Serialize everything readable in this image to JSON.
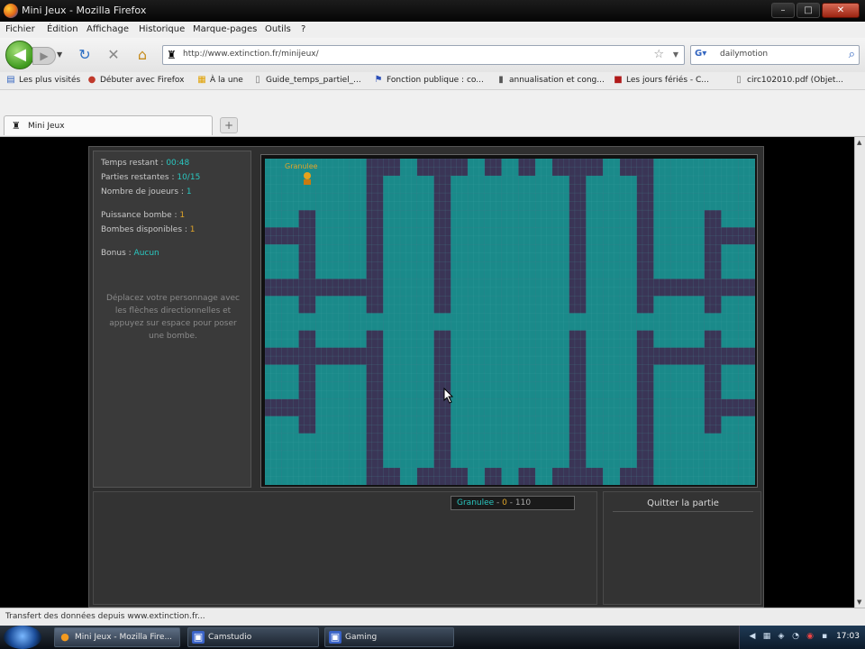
{
  "window": {
    "title": "Mini Jeux - Mozilla Firefox",
    "min": "–",
    "max": "□",
    "close": "✕"
  },
  "menu": [
    "Fichier",
    "Édition",
    "Affichage",
    "Historique",
    "Marque-pages",
    "Outils",
    "?"
  ],
  "nav": {
    "url": "http://www.extinction.fr/minijeux/",
    "search_value": "dailymotion",
    "search_engine_icon": "google-icon"
  },
  "bookmarks": [
    {
      "label": "Les plus visités",
      "icon": "bookmark-icon"
    },
    {
      "label": "Débuter avec Firefox",
      "icon": "firefox-icon"
    },
    {
      "label": "À la une",
      "icon": "rss-icon"
    },
    {
      "label": "Guide_temps_partiel_...",
      "icon": "page-icon"
    },
    {
      "label": "Fonction publique : co...",
      "icon": "flag-icon"
    },
    {
      "label": "annualisation et cong...",
      "icon": "page-icon"
    },
    {
      "label": "Les jours fériés - C...",
      "icon": "red-page-icon"
    },
    {
      "label": "circ102010.pdf (Objet...",
      "icon": "pdf-icon"
    }
  ],
  "tabs": [
    {
      "label": "Mini Jeux"
    }
  ],
  "game": {
    "stats": [
      {
        "label": "Temps restant :",
        "value": "00:48",
        "color": "teal"
      },
      {
        "label": "Parties restantes :",
        "value": "10/15",
        "color": "teal"
      },
      {
        "label": "Nombre de joueurs :",
        "value": "1",
        "color": "teal"
      },
      {
        "label": "Puissance bombe :",
        "value": "1",
        "color": "orange"
      },
      {
        "label": "Bombes disponibles :",
        "value": "1",
        "color": "orange"
      },
      {
        "label": "Bonus :",
        "value": "Aucun",
        "color": "teal"
      }
    ],
    "help": "Déplacez votre personnage avec les flèches directionnelles et appuyez sur espace pour poser une bombe.",
    "player_name": "Granulee",
    "score": {
      "name": "Granulee",
      "sep1": " - ",
      "kills": "0",
      "sep2": " - ",
      "points": "110"
    },
    "quit_label": "Quitter la partie",
    "colors": {
      "floor": "#1a8a8a",
      "wall": "#3a3556",
      "grid": "#4fb3b3"
    }
  },
  "status": "Transfert des données depuis www.extinction.fr...",
  "taskbar": {
    "tasks": [
      {
        "label": "Mini Jeux - Mozilla Fire...",
        "icon": "firefox-icon",
        "active": true
      },
      {
        "label": "Camstudio",
        "icon": "camstudio-icon",
        "active": false
      },
      {
        "label": "Gaming",
        "icon": "folder-icon",
        "active": false
      }
    ],
    "clock": "17:03"
  }
}
